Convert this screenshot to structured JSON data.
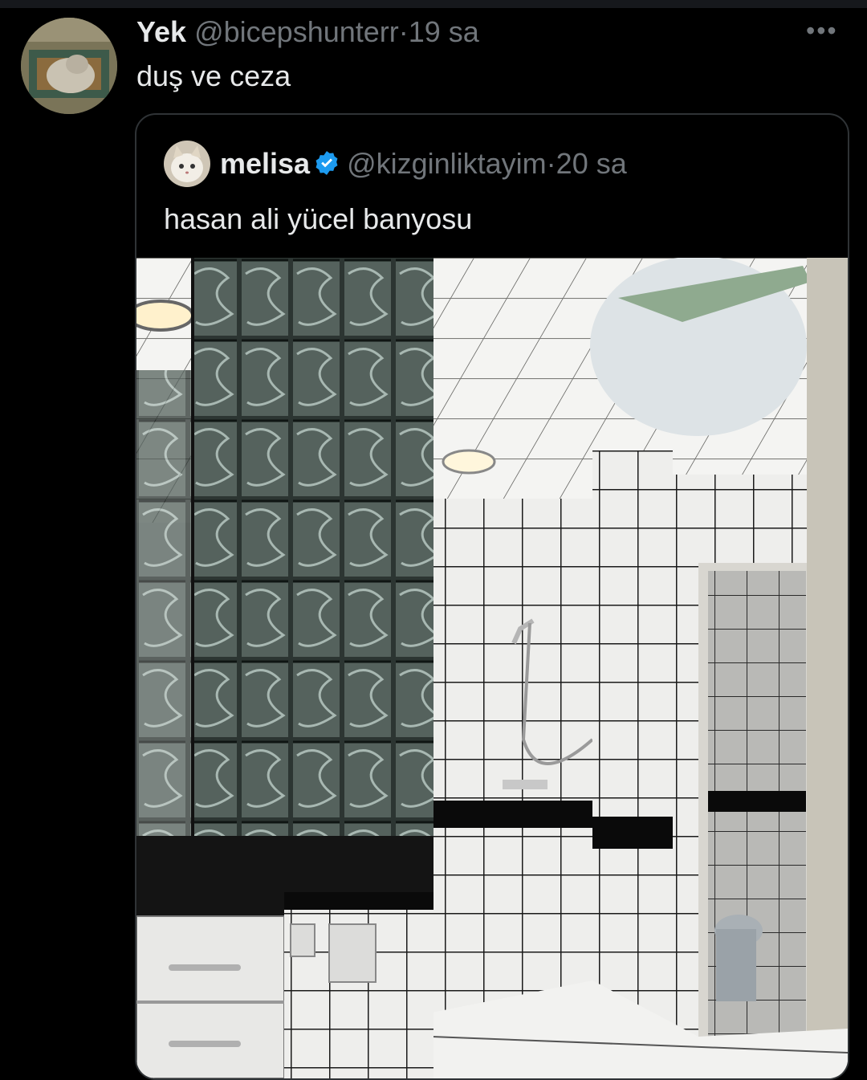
{
  "tweet": {
    "author_name": "Yek",
    "author_handle": "@bicepshunterr",
    "separator": "·",
    "time": "19 sa",
    "text": "duş ve ceza",
    "more_icon": "more-horizontal-icon",
    "more_label": "•••"
  },
  "quoted_tweet": {
    "author_name": "melisa",
    "verified": true,
    "author_handle": "@kizginliktayim",
    "separator": "·",
    "time": "20 sa",
    "text": "hasan ali yücel banyosu",
    "media_alt": "bathroom photo with glass block wall and white tiles"
  },
  "colors": {
    "background": "#000000",
    "text": "#e7e9ea",
    "muted": "#71767b",
    "border": "#2f3336",
    "verified": "#1d9bf0"
  }
}
